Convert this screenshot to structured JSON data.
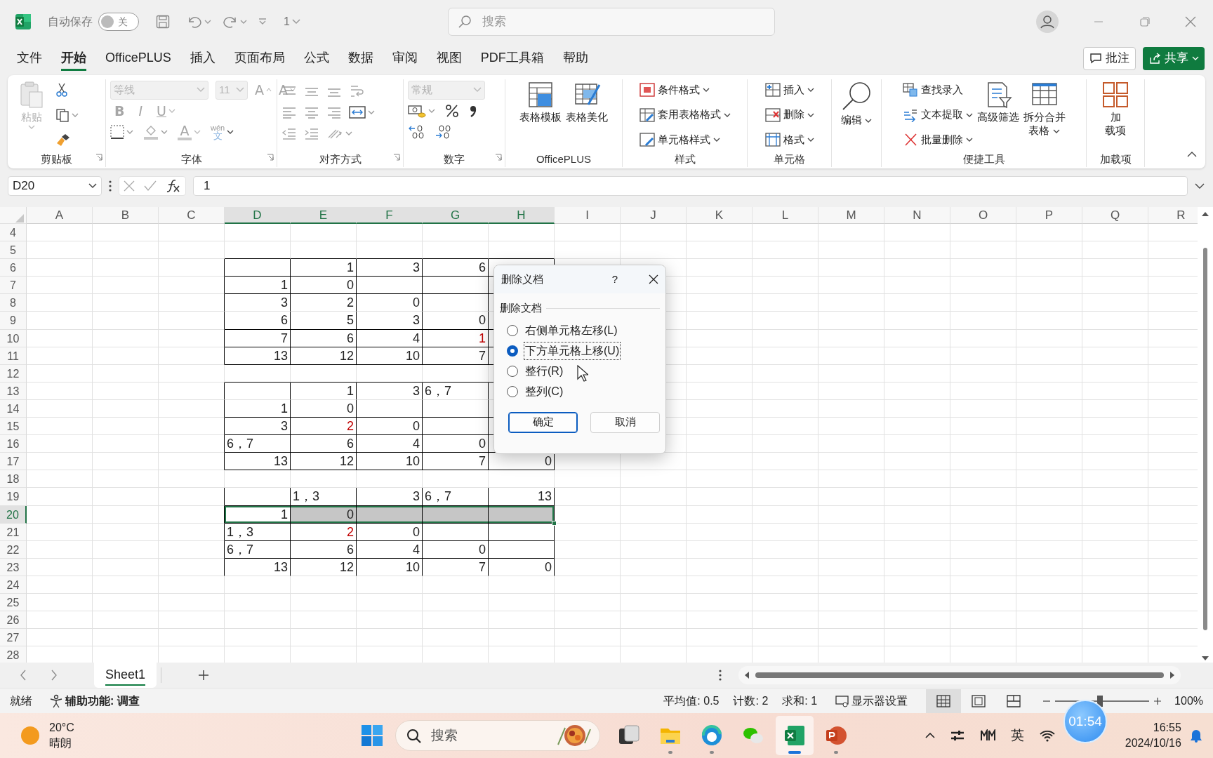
{
  "title_bar": {
    "autosave_label": "自动保存",
    "autosave": {
      "on": false,
      "label": "关"
    },
    "quick_access_value": "1",
    "search": {
      "placeholder": "搜索"
    }
  },
  "menu_tabs": [
    {
      "label": "文件",
      "selected": false
    },
    {
      "label": "开始",
      "selected": true
    },
    {
      "label": "OfficePLUS",
      "selected": false
    },
    {
      "label": "插入",
      "selected": false
    },
    {
      "label": "页面布局",
      "selected": false
    },
    {
      "label": "公式",
      "selected": false
    },
    {
      "label": "数据",
      "selected": false
    },
    {
      "label": "审阅",
      "selected": false
    },
    {
      "label": "视图",
      "selected": false
    },
    {
      "label": "PDF工具箱",
      "selected": false
    },
    {
      "label": "帮助",
      "selected": false
    }
  ],
  "header_buttons": [
    {
      "label": "批注",
      "kind": "comment",
      "caret": false
    },
    {
      "label": "共享",
      "kind": "share",
      "caret": true
    }
  ],
  "ribbon": {
    "groups": [
      {
        "label": "剪贴板",
        "launcher": true,
        "items": [
          {
            "label": "粘贴",
            "caret": true,
            "disabled": true
          }
        ]
      },
      {
        "label": "字体",
        "launcher": true,
        "items": [
          {
            "value": "等线",
            "disabled": true
          },
          {
            "value": "11",
            "disabled": true
          },
          {
            "text": "A",
            "disabled": true
          },
          {
            "text": "A",
            "disabled": true
          },
          {
            "text": "B",
            "disabled": true
          },
          {
            "text": "I",
            "disabled": true
          },
          {
            "text": "U",
            "disabled": true
          },
          {
            "text": "A",
            "disabled": true
          },
          {
            "text": "wén",
            "disabled": true
          },
          {
            "text": "文",
            "disabled": true
          }
        ]
      },
      {
        "label": "对齐方式",
        "launcher": true
      },
      {
        "label": "数字",
        "launcher": true,
        "items": [
          {
            "value": "常规",
            "disabled": true
          }
        ]
      },
      {
        "label": "OfficePLUS",
        "launcher": false,
        "items": [
          {
            "kind": "large",
            "label": "表格模板",
            "caret": false
          },
          {
            "kind": "large",
            "label": "表格美化",
            "caret": false
          }
        ]
      },
      {
        "label": "样式",
        "launcher": false,
        "items": [
          {
            "kind": "small",
            "label": "条件格式",
            "caret": true
          },
          {
            "kind": "small",
            "label": "套用表格格式",
            "caret": true
          },
          {
            "kind": "small",
            "label": "单元格样式",
            "caret": true
          }
        ]
      },
      {
        "label": "单元格",
        "launcher": false,
        "items": [
          {
            "kind": "small",
            "label": "插入",
            "caret": true
          },
          {
            "kind": "small",
            "label": "删除",
            "caret": true
          },
          {
            "kind": "small",
            "label": "格式",
            "caret": true
          }
        ]
      },
      {
        "launcher": false,
        "items": [
          {
            "kind": "large",
            "label": "编辑",
            "caret": true
          }
        ]
      },
      {
        "label": "便捷工具",
        "launcher": false,
        "items": [
          {
            "kind": "small",
            "label": "查找录入",
            "caret": false
          },
          {
            "kind": "small",
            "label": "文本提取",
            "caret": true
          },
          {
            "kind": "small",
            "label": "批量删除",
            "caret": true
          },
          {
            "kind": "large",
            "label": "高级筛选",
            "caret": false
          },
          {
            "kind": "large",
            "lines": [
              "拆分合并",
              "表格"
            ],
            "caret": true
          }
        ]
      },
      {
        "label": "加载项",
        "launcher": false,
        "items": [
          {
            "kind": "large",
            "lines": [
              "加",
              "载项"
            ],
            "caret": false
          }
        ]
      }
    ]
  },
  "formula_bar": {
    "name_box": "D20",
    "formula": "1"
  },
  "sheet": {
    "columns": [
      {
        "label": "A",
        "selected": false
      },
      {
        "label": "B",
        "selected": false
      },
      {
        "label": "C",
        "selected": false
      },
      {
        "label": "D",
        "selected": true
      },
      {
        "label": "E",
        "selected": true
      },
      {
        "label": "F",
        "selected": true
      },
      {
        "label": "G",
        "selected": true
      },
      {
        "label": "H",
        "selected": true
      },
      {
        "label": "I",
        "selected": false
      },
      {
        "label": "J",
        "selected": false
      },
      {
        "label": "K",
        "selected": false
      },
      {
        "label": "L",
        "selected": false
      },
      {
        "label": "M",
        "selected": false
      },
      {
        "label": "N",
        "selected": false
      },
      {
        "label": "O",
        "selected": false
      },
      {
        "label": "P",
        "selected": false
      },
      {
        "label": "Q",
        "selected": false
      },
      {
        "label": "R",
        "selected": false
      }
    ],
    "rows": [
      {
        "number": "4",
        "selected": false,
        "boxed": false,
        "rule": false
      },
      {
        "number": "5",
        "selected": false,
        "boxed": false,
        "rule": true
      },
      {
        "number": "6",
        "selected": false,
        "boxed": true,
        "rule": true,
        "cells": [
          null,
          null,
          null,
          null,
          {
            "kind": "number",
            "text": "1"
          },
          {
            "kind": "number",
            "text": "3"
          },
          {
            "kind": "number",
            "text": "6"
          },
          null
        ]
      },
      {
        "number": "7",
        "selected": false,
        "boxed": true,
        "rule": true,
        "cells": [
          null,
          null,
          null,
          {
            "kind": "number",
            "text": "1"
          },
          {
            "kind": "number",
            "text": "0"
          },
          null,
          null,
          null
        ]
      },
      {
        "number": "8",
        "selected": false,
        "boxed": true,
        "rule": false,
        "cells": [
          null,
          null,
          null,
          {
            "kind": "number",
            "text": "3"
          },
          {
            "kind": "number",
            "text": "2"
          },
          {
            "kind": "number",
            "text": "0"
          },
          null,
          null
        ]
      },
      {
        "number": "9",
        "selected": false,
        "boxed": true,
        "rule": true,
        "cells": [
          null,
          null,
          null,
          {
            "kind": "number",
            "text": "6"
          },
          {
            "kind": "number",
            "text": "5"
          },
          {
            "kind": "number",
            "text": "3"
          },
          {
            "kind": "number",
            "text": "0"
          },
          null
        ]
      },
      {
        "number": "10",
        "selected": false,
        "boxed": true,
        "rule": true,
        "cells": [
          null,
          null,
          null,
          {
            "kind": "number",
            "text": "7"
          },
          {
            "kind": "number",
            "text": "6"
          },
          {
            "kind": "number",
            "text": "4"
          },
          {
            "kind": "number",
            "text": "1",
            "color": "#c00000"
          },
          null
        ]
      },
      {
        "number": "11",
        "selected": false,
        "boxed": true,
        "rule": true,
        "cells": [
          null,
          null,
          null,
          {
            "kind": "number",
            "text": "13"
          },
          {
            "kind": "number",
            "text": "12"
          },
          {
            "kind": "number",
            "text": "10"
          },
          {
            "kind": "number",
            "text": "7"
          },
          null
        ]
      },
      {
        "number": "12",
        "selected": false,
        "boxed": false,
        "rule": true
      },
      {
        "number": "13",
        "selected": false,
        "boxed": true,
        "rule": false,
        "cells": [
          null,
          null,
          null,
          null,
          {
            "kind": "number",
            "text": "1"
          },
          {
            "kind": "number",
            "text": "3"
          },
          {
            "kind": "text",
            "text": "6，7"
          },
          null
        ]
      },
      {
        "number": "14",
        "selected": false,
        "boxed": true,
        "rule": true,
        "cells": [
          null,
          null,
          null,
          {
            "kind": "number",
            "text": "1"
          },
          {
            "kind": "number",
            "text": "0"
          },
          null,
          null,
          null
        ]
      },
      {
        "number": "15",
        "selected": false,
        "boxed": true,
        "rule": true,
        "cells": [
          null,
          null,
          null,
          {
            "kind": "number",
            "text": "3"
          },
          {
            "kind": "number",
            "text": "2",
            "color": "#c00000"
          },
          {
            "kind": "number",
            "text": "0"
          },
          null,
          null
        ]
      },
      {
        "number": "16",
        "selected": false,
        "boxed": true,
        "rule": true,
        "cells": [
          null,
          null,
          null,
          {
            "kind": "text",
            "text": "6，7"
          },
          {
            "kind": "number",
            "text": "6"
          },
          {
            "kind": "number",
            "text": "4"
          },
          {
            "kind": "number",
            "text": "0"
          },
          null
        ]
      },
      {
        "number": "17",
        "selected": false,
        "boxed": true,
        "rule": true,
        "cells": [
          null,
          null,
          null,
          {
            "kind": "number",
            "text": "13"
          },
          {
            "kind": "number",
            "text": "12"
          },
          {
            "kind": "number",
            "text": "10"
          },
          {
            "kind": "number",
            "text": "7"
          },
          {
            "kind": "number",
            "text": "0"
          }
        ]
      },
      {
        "number": "18",
        "selected": false,
        "boxed": false,
        "rule": false
      },
      {
        "number": "19",
        "selected": false,
        "boxed": true,
        "rule": true,
        "cells": [
          null,
          null,
          null,
          null,
          {
            "kind": "text",
            "text": "1，3"
          },
          {
            "kind": "number",
            "text": "3"
          },
          {
            "kind": "text",
            "text": "6，7"
          },
          {
            "kind": "number",
            "text": "13"
          }
        ]
      },
      {
        "number": "20",
        "selected": true,
        "boxed": true,
        "rule": true,
        "cells": [
          null,
          null,
          null,
          {
            "kind": "number",
            "text": "1",
            "active": true
          },
          {
            "kind": "number",
            "text": "0",
            "selected": true
          },
          {
            "kind": "blank",
            "selected": true
          },
          {
            "kind": "blank",
            "selected": true
          },
          {
            "kind": "blank",
            "selected": true
          }
        ]
      },
      {
        "number": "21",
        "selected": false,
        "boxed": true,
        "rule": true,
        "cells": [
          null,
          null,
          null,
          {
            "kind": "text",
            "text": "1，3"
          },
          {
            "kind": "number",
            "text": "2",
            "color": "#c00000"
          },
          {
            "kind": "number",
            "text": "0"
          },
          null,
          null
        ]
      },
      {
        "number": "22",
        "selected": false,
        "boxed": true,
        "rule": true,
        "cells": [
          null,
          null,
          null,
          {
            "kind": "text",
            "text": "6，7"
          },
          {
            "kind": "number",
            "text": "6"
          },
          {
            "kind": "number",
            "text": "4"
          },
          {
            "kind": "number",
            "text": "0"
          },
          null
        ]
      },
      {
        "number": "23",
        "selected": false,
        "boxed": true,
        "rule": false,
        "cells": [
          null,
          null,
          null,
          {
            "kind": "number",
            "text": "13"
          },
          {
            "kind": "number",
            "text": "12"
          },
          {
            "kind": "number",
            "text": "10"
          },
          {
            "kind": "number",
            "text": "7"
          },
          {
            "kind": "number",
            "text": "0"
          }
        ]
      },
      {
        "number": "24",
        "selected": false,
        "boxed": false,
        "rule": false
      },
      {
        "number": "25",
        "selected": false,
        "boxed": false,
        "rule": false
      },
      {
        "number": "26",
        "selected": false,
        "boxed": false,
        "rule": false
      },
      {
        "number": "27",
        "selected": false,
        "boxed": false,
        "rule": false
      },
      {
        "number": "28",
        "selected": false,
        "boxed": false
      }
    ]
  },
  "dialog": {
    "title": "删除义档",
    "help": "?",
    "group_label": "删除文档",
    "options": [
      {
        "label": "右侧单元格左移(L)",
        "selected": false,
        "focused": false
      },
      {
        "label": "下方单元格上移(U)",
        "selected": true,
        "focused": true
      },
      {
        "label": "整行(R)",
        "selected": false,
        "focused": false
      },
      {
        "label": "整列(C)",
        "selected": false,
        "focused": false
      }
    ],
    "buttons": [
      {
        "label": "确定",
        "default": true
      },
      {
        "label": "取消",
        "default": false
      }
    ]
  },
  "sheet_tabs": [
    {
      "label": "Sheet1",
      "selected": true
    }
  ],
  "status_bar": {
    "ready": "就绪",
    "accessibility": "辅助功能: 调查",
    "average": "平均值: 0.5",
    "count": "计数: 2",
    "sum": "求和: 1",
    "display_settings": "显示器设置",
    "views": [
      {
        "selected": true
      },
      {
        "selected": false
      },
      {
        "selected": false
      }
    ],
    "zoom": {
      "level": 0.48,
      "label": "100%"
    }
  },
  "taskbar": {
    "weather": {
      "temp": "20°C",
      "condition": "晴朗"
    },
    "search": {
      "placeholder": "搜索"
    },
    "apps": [
      {
        "running": false,
        "selected": false
      },
      {
        "running": true,
        "selected": false
      },
      {
        "running": true,
        "selected": false
      },
      {
        "running": false,
        "selected": false
      },
      {
        "running": true,
        "selected": true
      },
      {
        "running": true,
        "selected": false
      }
    ],
    "input_method": "英",
    "time": "16:55",
    "date": "2024/10/16",
    "timer": "01:54"
  }
}
